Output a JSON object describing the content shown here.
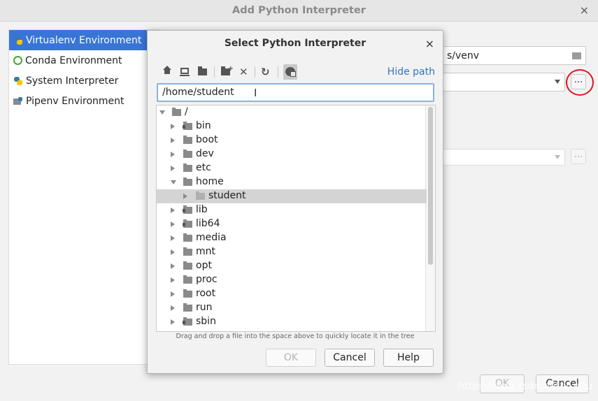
{
  "outer_dialog": {
    "title": "Add Python Interpreter",
    "close_glyph": "×",
    "environments": [
      {
        "label": "Virtualenv Environment",
        "icon": "virtualenv-icon",
        "selected": true
      },
      {
        "label": "Conda Environment",
        "icon": "conda-icon",
        "selected": false
      },
      {
        "label": "System Interpreter",
        "icon": "python-icon",
        "selected": false
      },
      {
        "label": "Pipenv Environment",
        "icon": "pipenv-icon",
        "selected": false
      }
    ],
    "location_value": "s/venv",
    "browse_label": "...",
    "ok_label": "OK",
    "cancel_label": "Cancel"
  },
  "dialog": {
    "title": "Select Python Interpreter",
    "close_glyph": "×",
    "toolbar": [
      "home-icon",
      "desktop-icon",
      "project-folder-icon",
      "new-folder-icon",
      "delete-icon",
      "refresh-icon",
      "show-hidden-icon"
    ],
    "delete_glyph": "✕",
    "refresh_glyph": "↻",
    "hide_path_label": "Hide path",
    "path_value": "/home/student",
    "ibeam_glyph": "I",
    "tree": [
      {
        "label": "/",
        "level": 0,
        "expanded": true
      },
      {
        "label": "bin",
        "level": 1,
        "expanded": false
      },
      {
        "label": "boot",
        "level": 1,
        "expanded": false
      },
      {
        "label": "dev",
        "level": 1,
        "expanded": false
      },
      {
        "label": "etc",
        "level": 1,
        "expanded": false
      },
      {
        "label": "home",
        "level": 1,
        "expanded": true
      },
      {
        "label": "student",
        "level": 2,
        "expanded": false,
        "selected": true
      },
      {
        "label": "lib",
        "level": 1,
        "expanded": false
      },
      {
        "label": "lib64",
        "level": 1,
        "expanded": false
      },
      {
        "label": "media",
        "level": 1,
        "expanded": false
      },
      {
        "label": "mnt",
        "level": 1,
        "expanded": false
      },
      {
        "label": "opt",
        "level": 1,
        "expanded": false
      },
      {
        "label": "proc",
        "level": 1,
        "expanded": false
      },
      {
        "label": "root",
        "level": 1,
        "expanded": false
      },
      {
        "label": "run",
        "level": 1,
        "expanded": false
      },
      {
        "label": "sbin",
        "level": 1,
        "expanded": false
      }
    ],
    "hint": "Drag and drop a file into the space above to quickly locate it in the tree",
    "ok_label": "OK",
    "cancel_label": "Cancel",
    "help_label": "Help"
  },
  "watermark": "https://blog.csdn.net/y_qjtu",
  "colors": {
    "selection": "#3875d7",
    "link": "#2f75c4",
    "annotation": "#e0141b"
  }
}
